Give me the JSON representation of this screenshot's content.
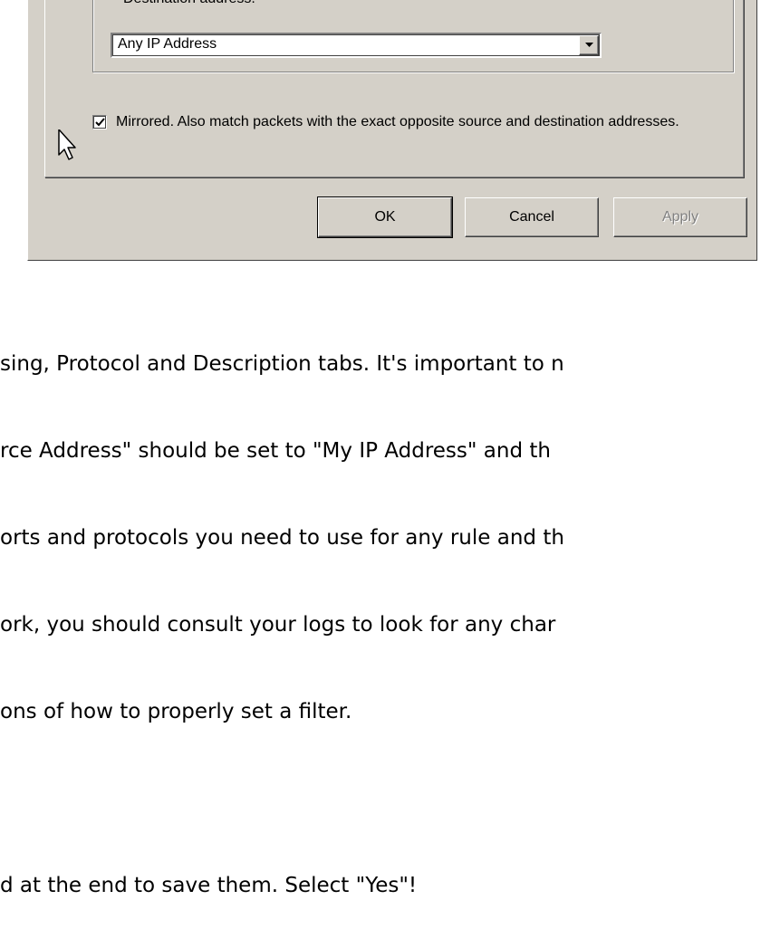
{
  "dialog": {
    "destination_group": {
      "label": "Destination address:",
      "combo_value": "Any IP Address"
    },
    "mirrored": {
      "checked": true,
      "label": "Mirrored. Also match packets with the exact opposite source and destination addresses."
    },
    "buttons": {
      "ok": "OK",
      "cancel": "Cancel",
      "apply": "Apply"
    }
  },
  "article": {
    "lines": [
      "sing, Protocol and Description tabs. It's important to n",
      "rce Address\" should be set to \"My IP Address\" and th",
      "orts and protocols you need to use for any rule and th",
      "ork, you should consult your logs to look for any char",
      "ons of how to properly set a filter."
    ],
    "last_line": "d at the end to save them. Select \"Yes\"!"
  }
}
